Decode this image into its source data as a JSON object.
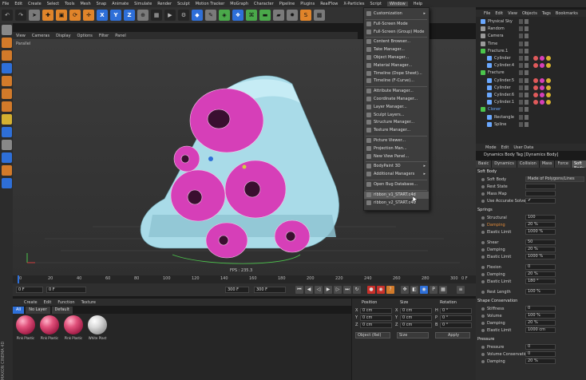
{
  "menubar": [
    "File",
    "Edit",
    "Create",
    "Select",
    "Tools",
    "Mesh",
    "Snap",
    "Animate",
    "Simulate",
    "Render",
    "Sculpt",
    "Motion Tracker",
    "MoGraph",
    "Character",
    "Pipeline",
    "Plugins",
    "RealFlow",
    "X-Particles",
    "Script",
    "Window",
    "Help"
  ],
  "viewport": {
    "menu": [
      "View",
      "Cameras",
      "Display",
      "Options",
      "Filter",
      "Panel"
    ],
    "label": "Parallel",
    "fps": "FPS : 235.3"
  },
  "timeline": {
    "ticks": [
      "0",
      "20",
      "40",
      "60",
      "80",
      "100",
      "120",
      "140",
      "160",
      "180",
      "200",
      "220",
      "240",
      "260",
      "280",
      "300"
    ],
    "end": "0 F",
    "start_field": "0 F",
    "cur_field": "0 F",
    "end_field": "300 F",
    "max_field": "300 F"
  },
  "window_menu": {
    "items": [
      {
        "label": "Customization",
        "sub": true
      },
      {
        "label": "Full-Screen Mode"
      },
      {
        "label": "Full-Screen (Group) Mode"
      },
      {
        "label": "Content Browser..."
      },
      {
        "label": "Take Manager..."
      },
      {
        "label": "Object Manager..."
      },
      {
        "label": "Material Manager..."
      },
      {
        "label": "Timeline (Dope Sheet)..."
      },
      {
        "label": "Timeline (F-Curve)..."
      },
      {
        "label": "Attribute Manager..."
      },
      {
        "label": "Coordinate Manager..."
      },
      {
        "label": "Layer Manager..."
      },
      {
        "label": "Sculpt Layers..."
      },
      {
        "label": "Structure Manager..."
      },
      {
        "label": "Texture Manager..."
      },
      {
        "label": "Picture Viewer..."
      },
      {
        "label": "Projection Man..."
      },
      {
        "label": "New View Panel..."
      },
      {
        "label": "BodyPaint 3D",
        "sub": true
      },
      {
        "label": "Additional Managers",
        "sub": true
      },
      {
        "label": "Open Bug Database..."
      },
      {
        "label": "ribbon_v1_START.c4d"
      },
      {
        "label": "ribbon_v2_START.c4d"
      }
    ]
  },
  "object_manager": {
    "menu": [
      "File",
      "Edit",
      "View",
      "Objects",
      "Tags",
      "Bookmarks"
    ],
    "objects": [
      {
        "name": "Physical Sky",
        "indent": 0
      },
      {
        "name": "Random",
        "indent": 0
      },
      {
        "name": "Camera",
        "indent": 0
      },
      {
        "name": "Time",
        "indent": 0
      },
      {
        "name": "Fracture.1",
        "indent": 0
      },
      {
        "name": "Cylinder",
        "indent": 1
      },
      {
        "name": "Cylinder.4",
        "indent": 1
      },
      {
        "name": "Fracture",
        "indent": 0
      },
      {
        "name": "Cylinder.5",
        "indent": 1
      },
      {
        "name": "Cylinder",
        "indent": 1
      },
      {
        "name": "Cylinder.6",
        "indent": 1
      },
      {
        "name": "Cylinder.1",
        "indent": 1
      },
      {
        "name": "Cloner",
        "indent": 0
      },
      {
        "name": "Rectangle",
        "indent": 1
      },
      {
        "name": "Spline",
        "indent": 1
      }
    ]
  },
  "attribute_manager": {
    "menu": [
      "Mode",
      "Edit",
      "User Data"
    ],
    "title": "Dynamics Body Tag [Dynamics Body]",
    "tabs": [
      "Basic",
      "Dynamics",
      "Collision",
      "Mass",
      "Force",
      "Soft Body"
    ],
    "sections": [
      {
        "title": "Soft Body",
        "rows": [
          {
            "label": "Soft Body",
            "value": "Made of Polygons/Lines",
            "wide": true
          },
          {
            "label": "Rest State",
            "value": ""
          },
          {
            "label": "Mass Map",
            "value": ""
          },
          {
            "label": "Use Accurate Solver",
            "value": "✔"
          }
        ]
      },
      {
        "title": "Springs",
        "rows": [
          {
            "label": "Structural",
            "value": "100"
          },
          {
            "label": "Damping",
            "value": "20 %",
            "orange": true
          },
          {
            "label": "Elastic Limit",
            "value": "1000 %"
          },
          {
            "label": "Shear",
            "value": "50"
          },
          {
            "label": "Damping",
            "value": "20 %"
          },
          {
            "label": "Elastic Limit",
            "value": "1000 %"
          },
          {
            "label": "Flexion",
            "value": "0"
          },
          {
            "label": "Damping",
            "value": "20 %"
          },
          {
            "label": "Elastic Limit",
            "value": "180 °"
          },
          {
            "label": "Rest Length",
            "value": "100 %"
          }
        ]
      },
      {
        "title": "Shape Conservation",
        "rows": [
          {
            "label": "Stiffness",
            "value": "0"
          },
          {
            "label": "Volume",
            "value": "100 %"
          },
          {
            "label": "Damping",
            "value": "20 %"
          },
          {
            "label": "Elastic Limit",
            "value": "1000 cm"
          }
        ]
      },
      {
        "title": "Pressure",
        "rows": [
          {
            "label": "Pressure",
            "value": "0"
          },
          {
            "label": "Volume Conservation",
            "value": "0"
          },
          {
            "label": "Damping",
            "value": "20 %"
          }
        ]
      }
    ]
  },
  "material_manager": {
    "menu": [
      "Create",
      "Edit",
      "Function",
      "Texture"
    ],
    "filters": [
      "All",
      "No Layer",
      "Default"
    ],
    "materials": [
      {
        "name": "Pink Plastic",
        "white": false
      },
      {
        "name": "Pink Plastic",
        "white": false
      },
      {
        "name": "Pink Plastic",
        "white": false
      },
      {
        "name": "White Plast",
        "white": true
      }
    ]
  },
  "coordinates": {
    "headers": [
      "Position",
      "Size",
      "Rotation"
    ],
    "rows": [
      {
        "axis": "X",
        "pos": "0 cm",
        "size": "0 cm",
        "rlabel": "H",
        "rot": "0 °"
      },
      {
        "axis": "Y",
        "pos": "0 cm",
        "size": "0 cm",
        "rlabel": "P",
        "rot": "0 °"
      },
      {
        "axis": "Z",
        "pos": "0 cm",
        "size": "0 cm",
        "rlabel": "B",
        "rot": "0 °"
      }
    ],
    "mode": "Object (Rel)",
    "size_mode": "Size",
    "apply": "Apply"
  },
  "side_label": "MAXON CINEMA 4D",
  "colors": {
    "accent": "#2e6fd8",
    "ribbon": "#a9dbe8",
    "cylinder": "#d63fb8",
    "orange": "#d27a2a"
  }
}
